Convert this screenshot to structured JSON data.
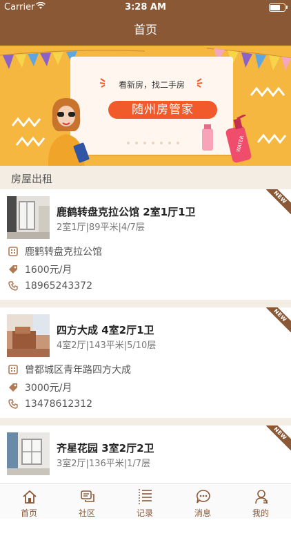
{
  "status_bar": {
    "carrier": "Carrier",
    "time": "3:28 AM"
  },
  "nav": {
    "title": "首页"
  },
  "banner": {
    "tagline": "看新房，找二手房",
    "brand": "随州房管家",
    "bottle_text": "WATER"
  },
  "section": {
    "title": "房屋出租"
  },
  "badge_text": "NEW",
  "listings": [
    {
      "title": "鹿鹤转盘克拉公馆 2室1厅1卫",
      "specs": "2室1厅|89平米|4/7层",
      "address": "鹿鹤转盘克拉公馆",
      "price": "1600元/月",
      "phone": "18965243372"
    },
    {
      "title": "四方大成 4室2厅1卫",
      "specs": "4室2厅|143平米|5/10层",
      "address": "曾都城区青年路四方大成",
      "price": "3000元/月",
      "phone": "13478612312"
    },
    {
      "title": "齐星花园 3室2厅2卫",
      "specs": "3室2厅|136平米|1/7层"
    }
  ],
  "tabs": [
    {
      "label": "首页",
      "icon": "home-icon"
    },
    {
      "label": "社区",
      "icon": "community-icon"
    },
    {
      "label": "记录",
      "icon": "list-icon"
    },
    {
      "label": "消息",
      "icon": "message-icon"
    },
    {
      "label": "我的",
      "icon": "profile-icon"
    }
  ],
  "colors": {
    "brand_brown": "#8b5836",
    "banner_yellow": "#f5b73f",
    "pill_red": "#f15a2b"
  }
}
